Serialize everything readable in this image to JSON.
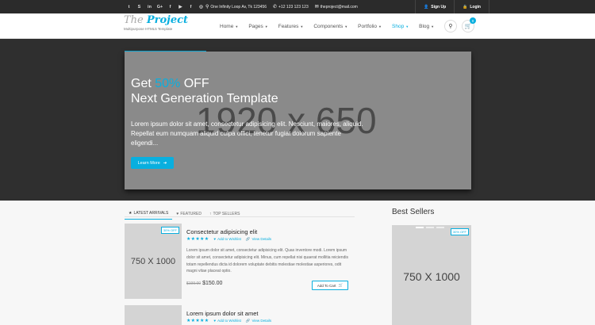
{
  "topbar": {
    "social": [
      "t",
      "S",
      "in",
      "G+",
      "f",
      "▶",
      "f",
      "◎"
    ],
    "address": "One Infinity Loop Av, Tk 123456",
    "phone": "+12 123 123 123",
    "email": "theproject@mail.com",
    "signup": "Sign Up",
    "login": "Login"
  },
  "header": {
    "logo_pre": "The ",
    "logo_main": "Project",
    "tagline": "Multipurpose HTML5 Template",
    "nav": [
      "Home",
      "Pages",
      "Features",
      "Components",
      "Portfolio",
      "Shop",
      "Blog"
    ],
    "active_nav": "Shop",
    "cart_count": "0"
  },
  "hero": {
    "title_pre": "Get ",
    "title_highlight": "50%",
    "title_post": " OFF",
    "title_line2": "Next Generation Template",
    "placeholder": "1920 x 650",
    "text": "Lorem ipsum dolor sit amet, consectetur adipisicing elit. Nesciunt, maiores, aliquid. Repellat eum numquam aliquid culpa offici, tenetur fugiat dolorum sapiente eligendi...",
    "button": "Learn More",
    "accent": "#09afdf"
  },
  "tabs": [
    {
      "icon": "★",
      "label": "LATEST ARRIVALS"
    },
    {
      "icon": "♥",
      "label": "FEATURED"
    },
    {
      "icon": "↑",
      "label": "TOP SELLERS"
    }
  ],
  "products": [
    {
      "image": "750 X 1000",
      "discount": "30% OFF",
      "name": "Consectetur adipisicing elit",
      "stars": "★★★★★",
      "wishlist": "Add to Wishlist",
      "details": "View Details",
      "description": "Lorem ipsum dolor sit amet, consectetur adipisicing elit. Quas inventore modi. Lorem ipsum dolor sit amet, consectetur adipisicing elit. Minus, cum repellat nisi quaerat mollitia reiciendis totam repellendus dicta id dolorem voluptate debitis molestiae molestiae asperiores, odit magni vitae placeat optio.",
      "old_price": "$199.00",
      "price": "$150.00",
      "cart": "Add To Cart"
    },
    {
      "name": "Lorem ipsum dolor sit amet",
      "stars": "★★★★★",
      "wishlist": "Add to Wishlist",
      "details": "View Details"
    }
  ],
  "best_sellers": {
    "title": "Best Sellers",
    "image": "750 X 1000",
    "discount": "30% OFF"
  }
}
